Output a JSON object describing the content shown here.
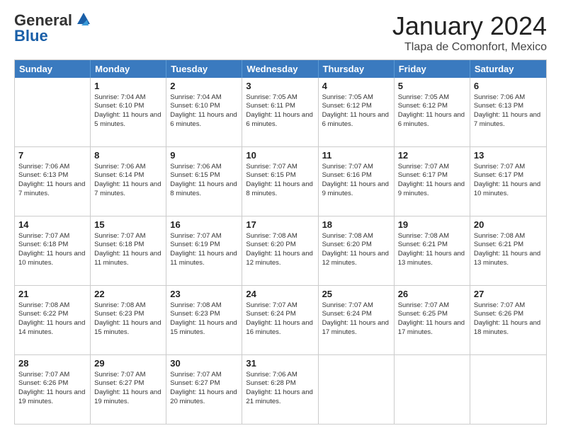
{
  "header": {
    "logo_line1": "General",
    "logo_line2": "Blue",
    "month_title": "January 2024",
    "location": "Tlapa de Comonfort, Mexico"
  },
  "weekdays": [
    "Sunday",
    "Monday",
    "Tuesday",
    "Wednesday",
    "Thursday",
    "Friday",
    "Saturday"
  ],
  "weeks": [
    [
      {
        "day": "",
        "sunrise": "",
        "sunset": "",
        "daylight": ""
      },
      {
        "day": "1",
        "sunrise": "Sunrise: 7:04 AM",
        "sunset": "Sunset: 6:10 PM",
        "daylight": "Daylight: 11 hours and 5 minutes."
      },
      {
        "day": "2",
        "sunrise": "Sunrise: 7:04 AM",
        "sunset": "Sunset: 6:10 PM",
        "daylight": "Daylight: 11 hours and 6 minutes."
      },
      {
        "day": "3",
        "sunrise": "Sunrise: 7:05 AM",
        "sunset": "Sunset: 6:11 PM",
        "daylight": "Daylight: 11 hours and 6 minutes."
      },
      {
        "day": "4",
        "sunrise": "Sunrise: 7:05 AM",
        "sunset": "Sunset: 6:12 PM",
        "daylight": "Daylight: 11 hours and 6 minutes."
      },
      {
        "day": "5",
        "sunrise": "Sunrise: 7:05 AM",
        "sunset": "Sunset: 6:12 PM",
        "daylight": "Daylight: 11 hours and 6 minutes."
      },
      {
        "day": "6",
        "sunrise": "Sunrise: 7:06 AM",
        "sunset": "Sunset: 6:13 PM",
        "daylight": "Daylight: 11 hours and 7 minutes."
      }
    ],
    [
      {
        "day": "7",
        "sunrise": "Sunrise: 7:06 AM",
        "sunset": "Sunset: 6:13 PM",
        "daylight": "Daylight: 11 hours and 7 minutes."
      },
      {
        "day": "8",
        "sunrise": "Sunrise: 7:06 AM",
        "sunset": "Sunset: 6:14 PM",
        "daylight": "Daylight: 11 hours and 7 minutes."
      },
      {
        "day": "9",
        "sunrise": "Sunrise: 7:06 AM",
        "sunset": "Sunset: 6:15 PM",
        "daylight": "Daylight: 11 hours and 8 minutes."
      },
      {
        "day": "10",
        "sunrise": "Sunrise: 7:07 AM",
        "sunset": "Sunset: 6:15 PM",
        "daylight": "Daylight: 11 hours and 8 minutes."
      },
      {
        "day": "11",
        "sunrise": "Sunrise: 7:07 AM",
        "sunset": "Sunset: 6:16 PM",
        "daylight": "Daylight: 11 hours and 9 minutes."
      },
      {
        "day": "12",
        "sunrise": "Sunrise: 7:07 AM",
        "sunset": "Sunset: 6:17 PM",
        "daylight": "Daylight: 11 hours and 9 minutes."
      },
      {
        "day": "13",
        "sunrise": "Sunrise: 7:07 AM",
        "sunset": "Sunset: 6:17 PM",
        "daylight": "Daylight: 11 hours and 10 minutes."
      }
    ],
    [
      {
        "day": "14",
        "sunrise": "Sunrise: 7:07 AM",
        "sunset": "Sunset: 6:18 PM",
        "daylight": "Daylight: 11 hours and 10 minutes."
      },
      {
        "day": "15",
        "sunrise": "Sunrise: 7:07 AM",
        "sunset": "Sunset: 6:18 PM",
        "daylight": "Daylight: 11 hours and 11 minutes."
      },
      {
        "day": "16",
        "sunrise": "Sunrise: 7:07 AM",
        "sunset": "Sunset: 6:19 PM",
        "daylight": "Daylight: 11 hours and 11 minutes."
      },
      {
        "day": "17",
        "sunrise": "Sunrise: 7:08 AM",
        "sunset": "Sunset: 6:20 PM",
        "daylight": "Daylight: 11 hours and 12 minutes."
      },
      {
        "day": "18",
        "sunrise": "Sunrise: 7:08 AM",
        "sunset": "Sunset: 6:20 PM",
        "daylight": "Daylight: 11 hours and 12 minutes."
      },
      {
        "day": "19",
        "sunrise": "Sunrise: 7:08 AM",
        "sunset": "Sunset: 6:21 PM",
        "daylight": "Daylight: 11 hours and 13 minutes."
      },
      {
        "day": "20",
        "sunrise": "Sunrise: 7:08 AM",
        "sunset": "Sunset: 6:21 PM",
        "daylight": "Daylight: 11 hours and 13 minutes."
      }
    ],
    [
      {
        "day": "21",
        "sunrise": "Sunrise: 7:08 AM",
        "sunset": "Sunset: 6:22 PM",
        "daylight": "Daylight: 11 hours and 14 minutes."
      },
      {
        "day": "22",
        "sunrise": "Sunrise: 7:08 AM",
        "sunset": "Sunset: 6:23 PM",
        "daylight": "Daylight: 11 hours and 15 minutes."
      },
      {
        "day": "23",
        "sunrise": "Sunrise: 7:08 AM",
        "sunset": "Sunset: 6:23 PM",
        "daylight": "Daylight: 11 hours and 15 minutes."
      },
      {
        "day": "24",
        "sunrise": "Sunrise: 7:07 AM",
        "sunset": "Sunset: 6:24 PM",
        "daylight": "Daylight: 11 hours and 16 minutes."
      },
      {
        "day": "25",
        "sunrise": "Sunrise: 7:07 AM",
        "sunset": "Sunset: 6:24 PM",
        "daylight": "Daylight: 11 hours and 17 minutes."
      },
      {
        "day": "26",
        "sunrise": "Sunrise: 7:07 AM",
        "sunset": "Sunset: 6:25 PM",
        "daylight": "Daylight: 11 hours and 17 minutes."
      },
      {
        "day": "27",
        "sunrise": "Sunrise: 7:07 AM",
        "sunset": "Sunset: 6:26 PM",
        "daylight": "Daylight: 11 hours and 18 minutes."
      }
    ],
    [
      {
        "day": "28",
        "sunrise": "Sunrise: 7:07 AM",
        "sunset": "Sunset: 6:26 PM",
        "daylight": "Daylight: 11 hours and 19 minutes."
      },
      {
        "day": "29",
        "sunrise": "Sunrise: 7:07 AM",
        "sunset": "Sunset: 6:27 PM",
        "daylight": "Daylight: 11 hours and 19 minutes."
      },
      {
        "day": "30",
        "sunrise": "Sunrise: 7:07 AM",
        "sunset": "Sunset: 6:27 PM",
        "daylight": "Daylight: 11 hours and 20 minutes."
      },
      {
        "day": "31",
        "sunrise": "Sunrise: 7:06 AM",
        "sunset": "Sunset: 6:28 PM",
        "daylight": "Daylight: 11 hours and 21 minutes."
      },
      {
        "day": "",
        "sunrise": "",
        "sunset": "",
        "daylight": ""
      },
      {
        "day": "",
        "sunrise": "",
        "sunset": "",
        "daylight": ""
      },
      {
        "day": "",
        "sunrise": "",
        "sunset": "",
        "daylight": ""
      }
    ]
  ]
}
